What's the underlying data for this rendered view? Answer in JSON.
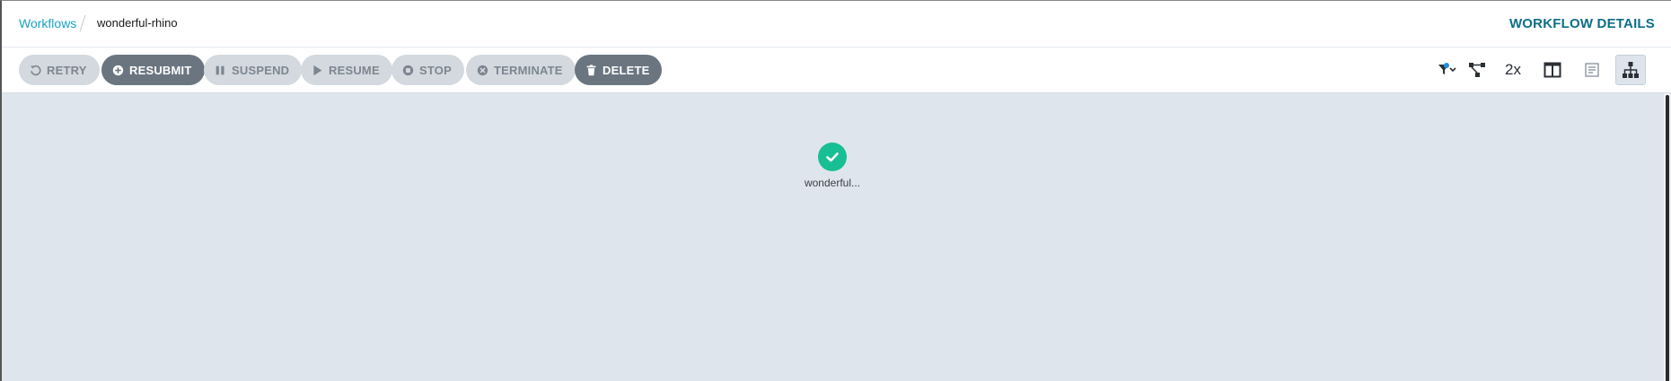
{
  "breadcrumb": {
    "parent": "Workflows",
    "current": "wonderful-rhino"
  },
  "header": {
    "details_link": "WORKFLOW DETAILS"
  },
  "toolbar": {
    "buttons": [
      {
        "label": "RETRY",
        "icon": "retry-icon",
        "style": "disabled"
      },
      {
        "label": "RESUBMIT",
        "icon": "plus-circle-icon",
        "style": "active"
      },
      {
        "label": "SUSPEND",
        "icon": "pause-icon",
        "style": "disabled"
      },
      {
        "label": "RESUME",
        "icon": "play-icon",
        "style": "disabled"
      },
      {
        "label": "STOP",
        "icon": "stop-circle-icon",
        "style": "disabled"
      },
      {
        "label": "TERMINATE",
        "icon": "x-circle-icon",
        "style": "disabled"
      },
      {
        "label": "DELETE",
        "icon": "trash-icon",
        "style": "active"
      }
    ],
    "zoom": "2x",
    "view_tools": [
      "filter-icon",
      "graph-icon",
      "zoom-toggle",
      "split-view-icon",
      "list-view-icon",
      "tree-view-icon"
    ]
  },
  "graph": {
    "nodes": [
      {
        "label": "wonderful...",
        "status": "succeeded",
        "status_color": "#18be94"
      }
    ]
  },
  "colors": {
    "accent": "#1aa3c4",
    "details": "#0e6e88",
    "canvas": "#dfe5ec",
    "button_disabled": "#d3d9df",
    "button_active": "#6a7580",
    "success": "#18be94"
  }
}
